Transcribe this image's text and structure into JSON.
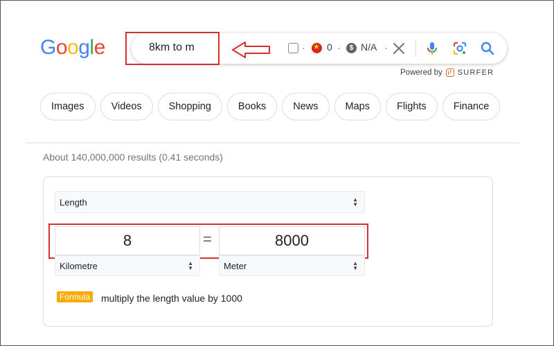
{
  "logo": "Google",
  "search": {
    "query": "8km to m",
    "extension": {
      "vn_count": "0",
      "usd_value": "N/A"
    },
    "powered_by": "Powered by",
    "powered_brand": "SURFER"
  },
  "chips": [
    "Images",
    "Videos",
    "Shopping",
    "Books",
    "News",
    "Maps",
    "Flights",
    "Finance"
  ],
  "result_stats": "About 140,000,000 results (0.41 seconds)",
  "converter": {
    "unit_type": "Length",
    "from_value": "8",
    "to_value": "8000",
    "equals": "=",
    "from_unit": "Kilometre",
    "to_unit": "Meter",
    "formula_label": "Formula",
    "formula_text": "multiply the length value by 1000"
  },
  "colors": {
    "highlight": "#d32f2f",
    "google_blue": "#4285f4",
    "google_red": "#ea4335",
    "google_yellow": "#fbbc05",
    "google_green": "#34a853",
    "formula_badge": "#f9ab00"
  }
}
